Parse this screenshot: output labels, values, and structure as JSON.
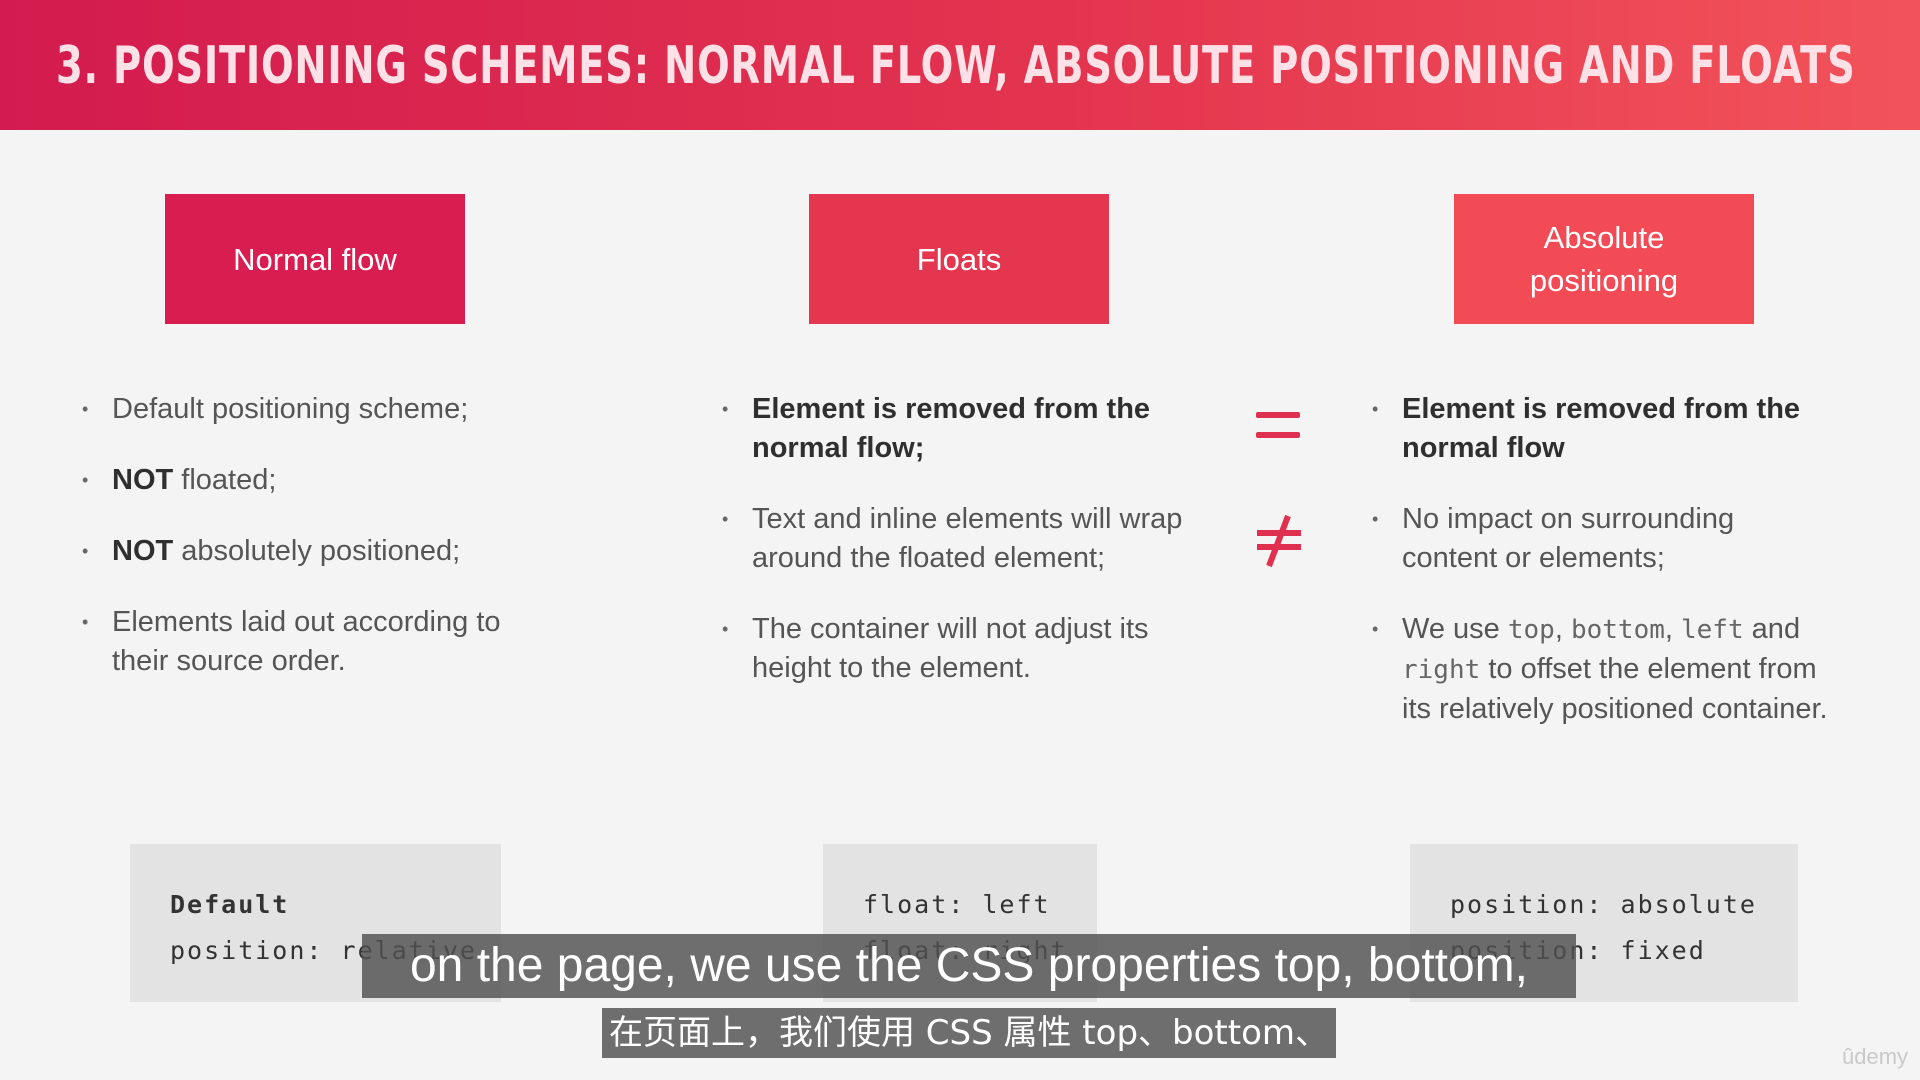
{
  "header": {
    "title": "3. POSITIONING SCHEMES: NORMAL FLOW, ABSOLUTE POSITIONING AND FLOATS",
    "colors": {
      "start": "#d31b4f",
      "end": "#f2535a"
    }
  },
  "columns": [
    {
      "box_label": "Normal flow",
      "box_color": "#d91d50",
      "bullets": [
        {
          "text": "Default positioning scheme;"
        },
        {
          "bold": "NOT",
          "text": " floated;"
        },
        {
          "bold": "NOT",
          "text": " absolutely positioned;"
        },
        {
          "text": "Elements laid out according to their source order."
        }
      ],
      "code": [
        {
          "text": "Default",
          "bold": true
        },
        {
          "text": "position: relative",
          "bold": false
        }
      ]
    },
    {
      "box_label": "Floats",
      "box_color": "#e4374f",
      "bullets": [
        {
          "bold": "Element is removed from the normal flow;",
          "text": ""
        },
        {
          "text": "Text and inline elements will wrap around the floated element;"
        },
        {
          "text": "The container will not adjust its height to the element."
        }
      ],
      "code": [
        {
          "text": "float: left"
        },
        {
          "text": "float: right"
        }
      ]
    },
    {
      "box_label": "Absolute\npositioning",
      "box_color": "#f24b55",
      "bullets": [
        {
          "bold": "Element is removed from the normal flow",
          "text": ""
        },
        {
          "text": "No impact on surrounding content or elements;"
        },
        {
          "parts": [
            {
              "t": "We use "
            },
            {
              "m": "top"
            },
            {
              "t": ", "
            },
            {
              "m": "bottom"
            },
            {
              "t": ", "
            },
            {
              "m": "left"
            },
            {
              "t": " and "
            },
            {
              "m": "right"
            },
            {
              "t": " to offset the element from its relatively positioned container."
            }
          ]
        }
      ],
      "code": [
        {
          "text": "position: absolute"
        },
        {
          "text": "position: fixed"
        }
      ]
    }
  ],
  "symbols": {
    "equal": "=",
    "not_equal": "≠",
    "color": "#e0304f"
  },
  "subtitles": {
    "english": "on the page, we use the CSS properties top, bottom,",
    "chinese": "在页面上，我们使用 CSS 属性 top、bottom、"
  },
  "watermark": "ûdemy"
}
